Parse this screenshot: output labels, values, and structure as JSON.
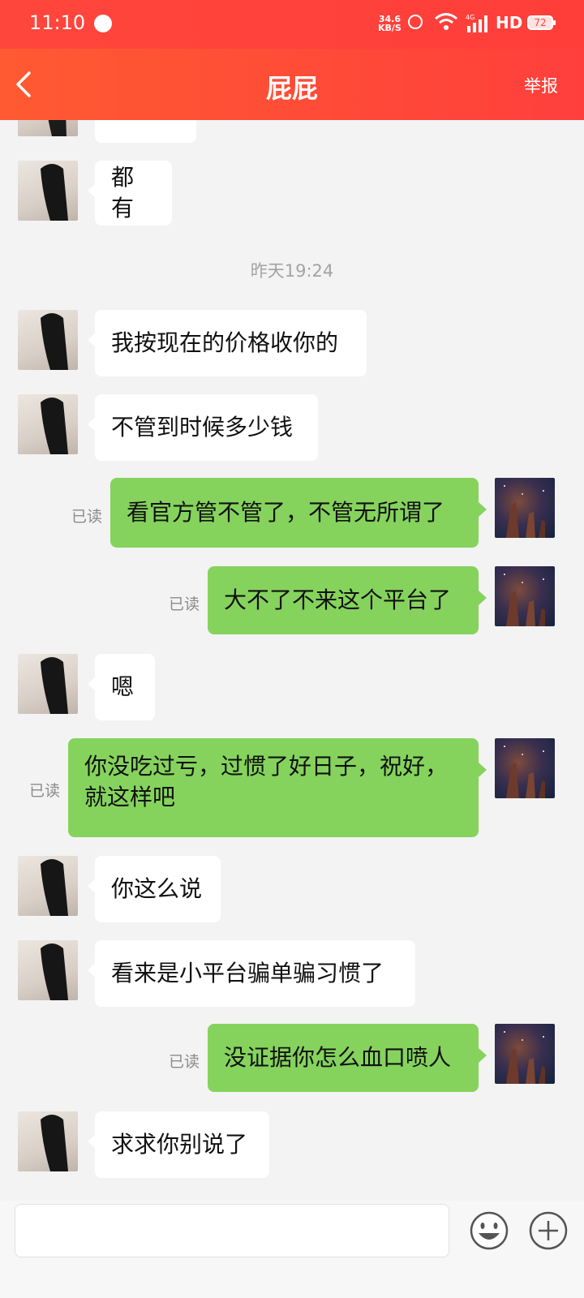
{
  "status_bar": {
    "time": "11:10",
    "net_speed_value": "34.6",
    "net_speed_unit": "KB/S",
    "network_type": "4G",
    "hd": "HD",
    "battery": "72"
  },
  "header": {
    "title": "屁屁",
    "report_label": "举报",
    "accent_color": "#ff463c"
  },
  "chat": {
    "timestamp": "昨天19:24",
    "read_label": "已读",
    "messages": [
      {
        "dir": "in",
        "text": ""
      },
      {
        "dir": "in",
        "text": "都有"
      },
      {
        "dir": "in",
        "text": "我按现在的价格收你的"
      },
      {
        "dir": "in",
        "text": "不管到时候多少钱"
      },
      {
        "dir": "out",
        "text": "看官方管不管了，不管无所谓了"
      },
      {
        "dir": "out",
        "text": "大不了不来这个平台了"
      },
      {
        "dir": "in",
        "text": "嗯"
      },
      {
        "dir": "out",
        "text": "你没吃过亏，过惯了好日子，祝好，就这样吧"
      },
      {
        "dir": "in",
        "text": "你这么说"
      },
      {
        "dir": "in",
        "text": "看来是小平台骗单骗习惯了"
      },
      {
        "dir": "out",
        "text": "没证据你怎么血口喷人"
      },
      {
        "dir": "in",
        "text": "求求你别说了"
      }
    ]
  },
  "input_bar": {
    "placeholder": "",
    "emoji_icon": "emoji-smile-icon",
    "plus_icon": "plus-circle-icon"
  }
}
